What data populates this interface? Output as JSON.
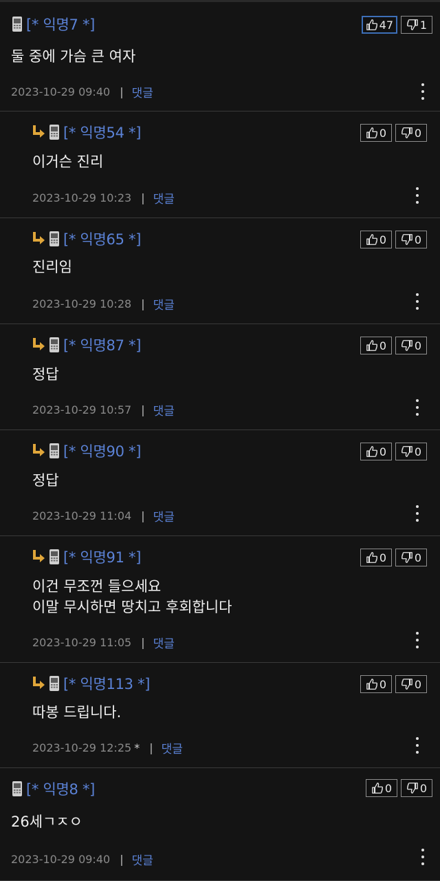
{
  "comments": [
    {
      "author": "[* 익명7 *]",
      "body": "둘 중에 가슴 큰 여자",
      "date": "2023-10-29 09:40",
      "edited": "",
      "reply_label": "댓글",
      "likes": "47",
      "dislikes": "1",
      "is_reply": false,
      "like_active": true
    },
    {
      "author": "[* 익명54 *]",
      "body": "이거슨 진리",
      "date": "2023-10-29 10:23",
      "edited": "",
      "reply_label": "댓글",
      "likes": "0",
      "dislikes": "0",
      "is_reply": true,
      "like_active": false
    },
    {
      "author": "[* 익명65 *]",
      "body": "진리임",
      "date": "2023-10-29 10:28",
      "edited": "",
      "reply_label": "댓글",
      "likes": "0",
      "dislikes": "0",
      "is_reply": true,
      "like_active": false
    },
    {
      "author": "[* 익명87 *]",
      "body": "정답",
      "date": "2023-10-29 10:57",
      "edited": "",
      "reply_label": "댓글",
      "likes": "0",
      "dislikes": "0",
      "is_reply": true,
      "like_active": false
    },
    {
      "author": "[* 익명90 *]",
      "body": "정답",
      "date": "2023-10-29 11:04",
      "edited": "",
      "reply_label": "댓글",
      "likes": "0",
      "dislikes": "0",
      "is_reply": true,
      "like_active": false
    },
    {
      "author": "[* 익명91 *]",
      "body": "이건 무조껀 들으세요\n이말 무시하면 땅치고 후회합니다",
      "date": "2023-10-29 11:05",
      "edited": "",
      "reply_label": "댓글",
      "likes": "0",
      "dislikes": "0",
      "is_reply": true,
      "like_active": false
    },
    {
      "author": "[* 익명113 *]",
      "body": "따봉 드립니다.",
      "date": "2023-10-29 12:25",
      "edited": "*",
      "reply_label": "댓글",
      "likes": "0",
      "dislikes": "0",
      "is_reply": true,
      "like_active": false
    },
    {
      "author": "[* 익명8 *]",
      "body": "26세ㄱㅈㅇ",
      "date": "2023-10-29 09:40",
      "edited": "",
      "reply_label": "댓글",
      "likes": "0",
      "dislikes": "0",
      "is_reply": false,
      "like_active": false
    }
  ],
  "icons": {
    "phone": "phone-icon",
    "reply_arrow": "reply-arrow-icon",
    "thumbs_up": "thumbs-up-icon",
    "thumbs_down": "thumbs-down-icon",
    "more": "more-vertical-icon"
  },
  "colors": {
    "background": "#141414",
    "author": "#5b82d6",
    "reply_link": "#5b82d6",
    "arrow": "#e0a63a",
    "active_border": "#3d6fb8"
  }
}
